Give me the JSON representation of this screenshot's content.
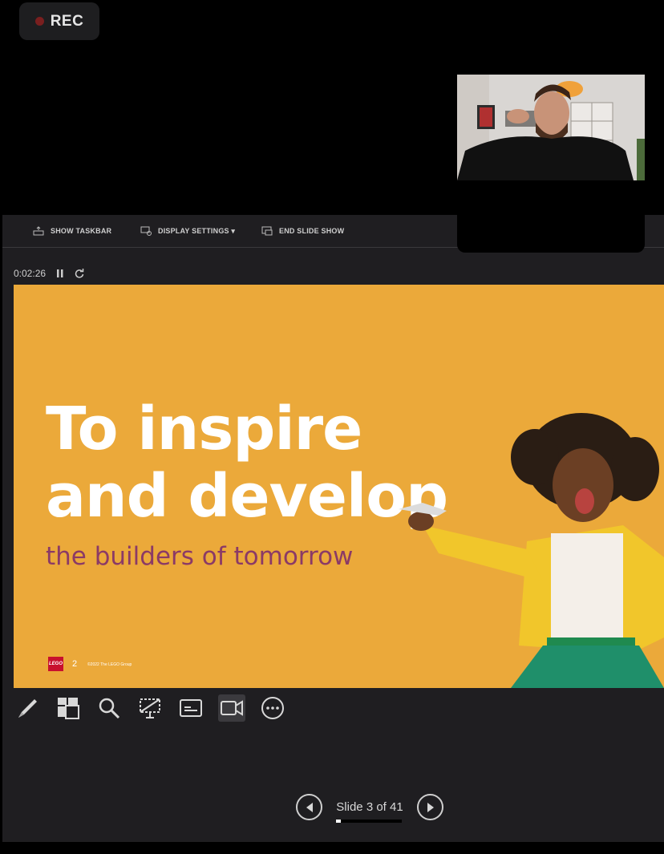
{
  "recording": {
    "label": "REC"
  },
  "toolbar": {
    "show_taskbar": "SHOW TASKBAR",
    "display_settings": "DISPLAY SETTINGS ▾",
    "end_slide_show": "END SLIDE SHOW"
  },
  "timer": {
    "elapsed": "0:02:26",
    "pause_icon": "pause-icon",
    "restart_icon": "restart-icon"
  },
  "slide": {
    "title_line1": "To inspire",
    "title_line2": "and develop",
    "subtitle": "the builders of tomorrow",
    "logo_text": "LEGO",
    "page_number": "2",
    "copyright": "©2022 The LEGO Group",
    "background_color": "#eba93a",
    "title_color": "#ffffff",
    "subtitle_color": "#8b3a66"
  },
  "tools": [
    {
      "name": "pen-tool-icon",
      "active": false
    },
    {
      "name": "see-all-slides-icon",
      "active": false
    },
    {
      "name": "zoom-icon",
      "active": false
    },
    {
      "name": "black-screen-icon",
      "active": false
    },
    {
      "name": "subtitles-icon",
      "active": false
    },
    {
      "name": "camera-icon",
      "active": true
    },
    {
      "name": "more-options-icon",
      "active": false
    }
  ],
  "navigation": {
    "slide_counter": "Slide 3 of 41",
    "current_slide": 3,
    "total_slides": 41,
    "progress_fraction": 0.07
  }
}
